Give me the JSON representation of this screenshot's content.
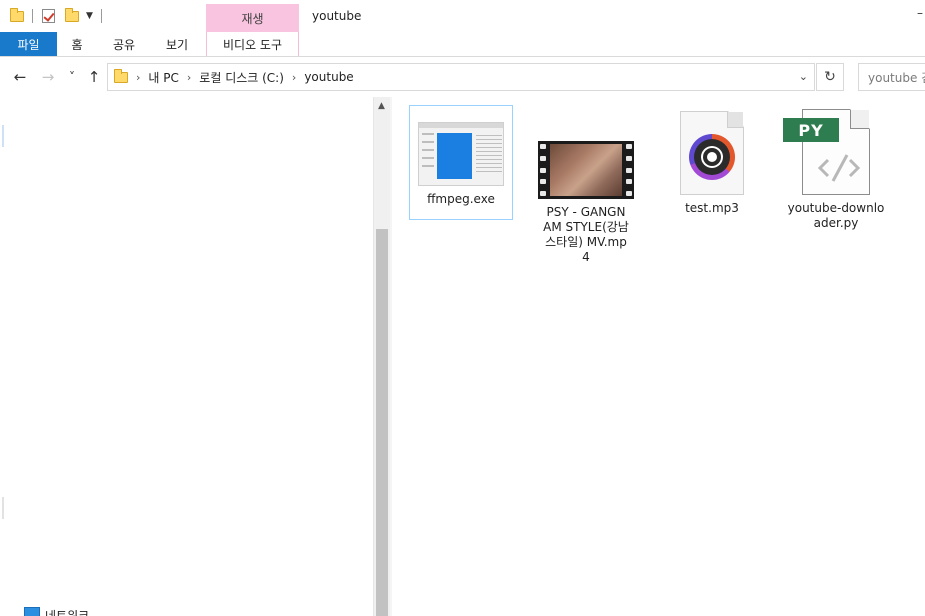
{
  "window": {
    "title": "youtube",
    "context_tab_header": "재생",
    "minimize_glyph": "–"
  },
  "ribbon": {
    "tabs": [
      {
        "label": "파일"
      },
      {
        "label": "홈"
      },
      {
        "label": "공유"
      },
      {
        "label": "보기"
      },
      {
        "label": "비디오 도구"
      }
    ]
  },
  "nav": {
    "back_icon": "←",
    "forward_icon": "→",
    "recent_icon": "˅",
    "up_icon": "↑",
    "breadcrumb": [
      "내 PC",
      "로컬 디스크 (C:)",
      "youtube"
    ],
    "breadcrumb_separator": "›",
    "dropdown_icon": "⌄",
    "refresh_icon": "↻",
    "search_placeholder": "youtube 검색"
  },
  "navpane": {
    "partial_item_label": "네트워크"
  },
  "files": [
    {
      "name": "ffmpeg.exe",
      "icon": "application-thumbnail-icon",
      "selected": true
    },
    {
      "name": "PSY - GANGNAM STYLE(강남스타일) MV.mp4",
      "icon": "video-thumbnail-icon",
      "selected": false
    },
    {
      "name": "test.mp3",
      "icon": "audio-file-icon",
      "selected": false
    },
    {
      "name": "youtube-downloader.py",
      "icon": "python-file-icon",
      "selected": false
    }
  ],
  "colors": {
    "file_tab": "#1979ca",
    "context_tab": "#f9c4e0",
    "selection_border": "#99d1ff",
    "py_badge": "#2e7d50"
  },
  "py_badge_text": "PY"
}
